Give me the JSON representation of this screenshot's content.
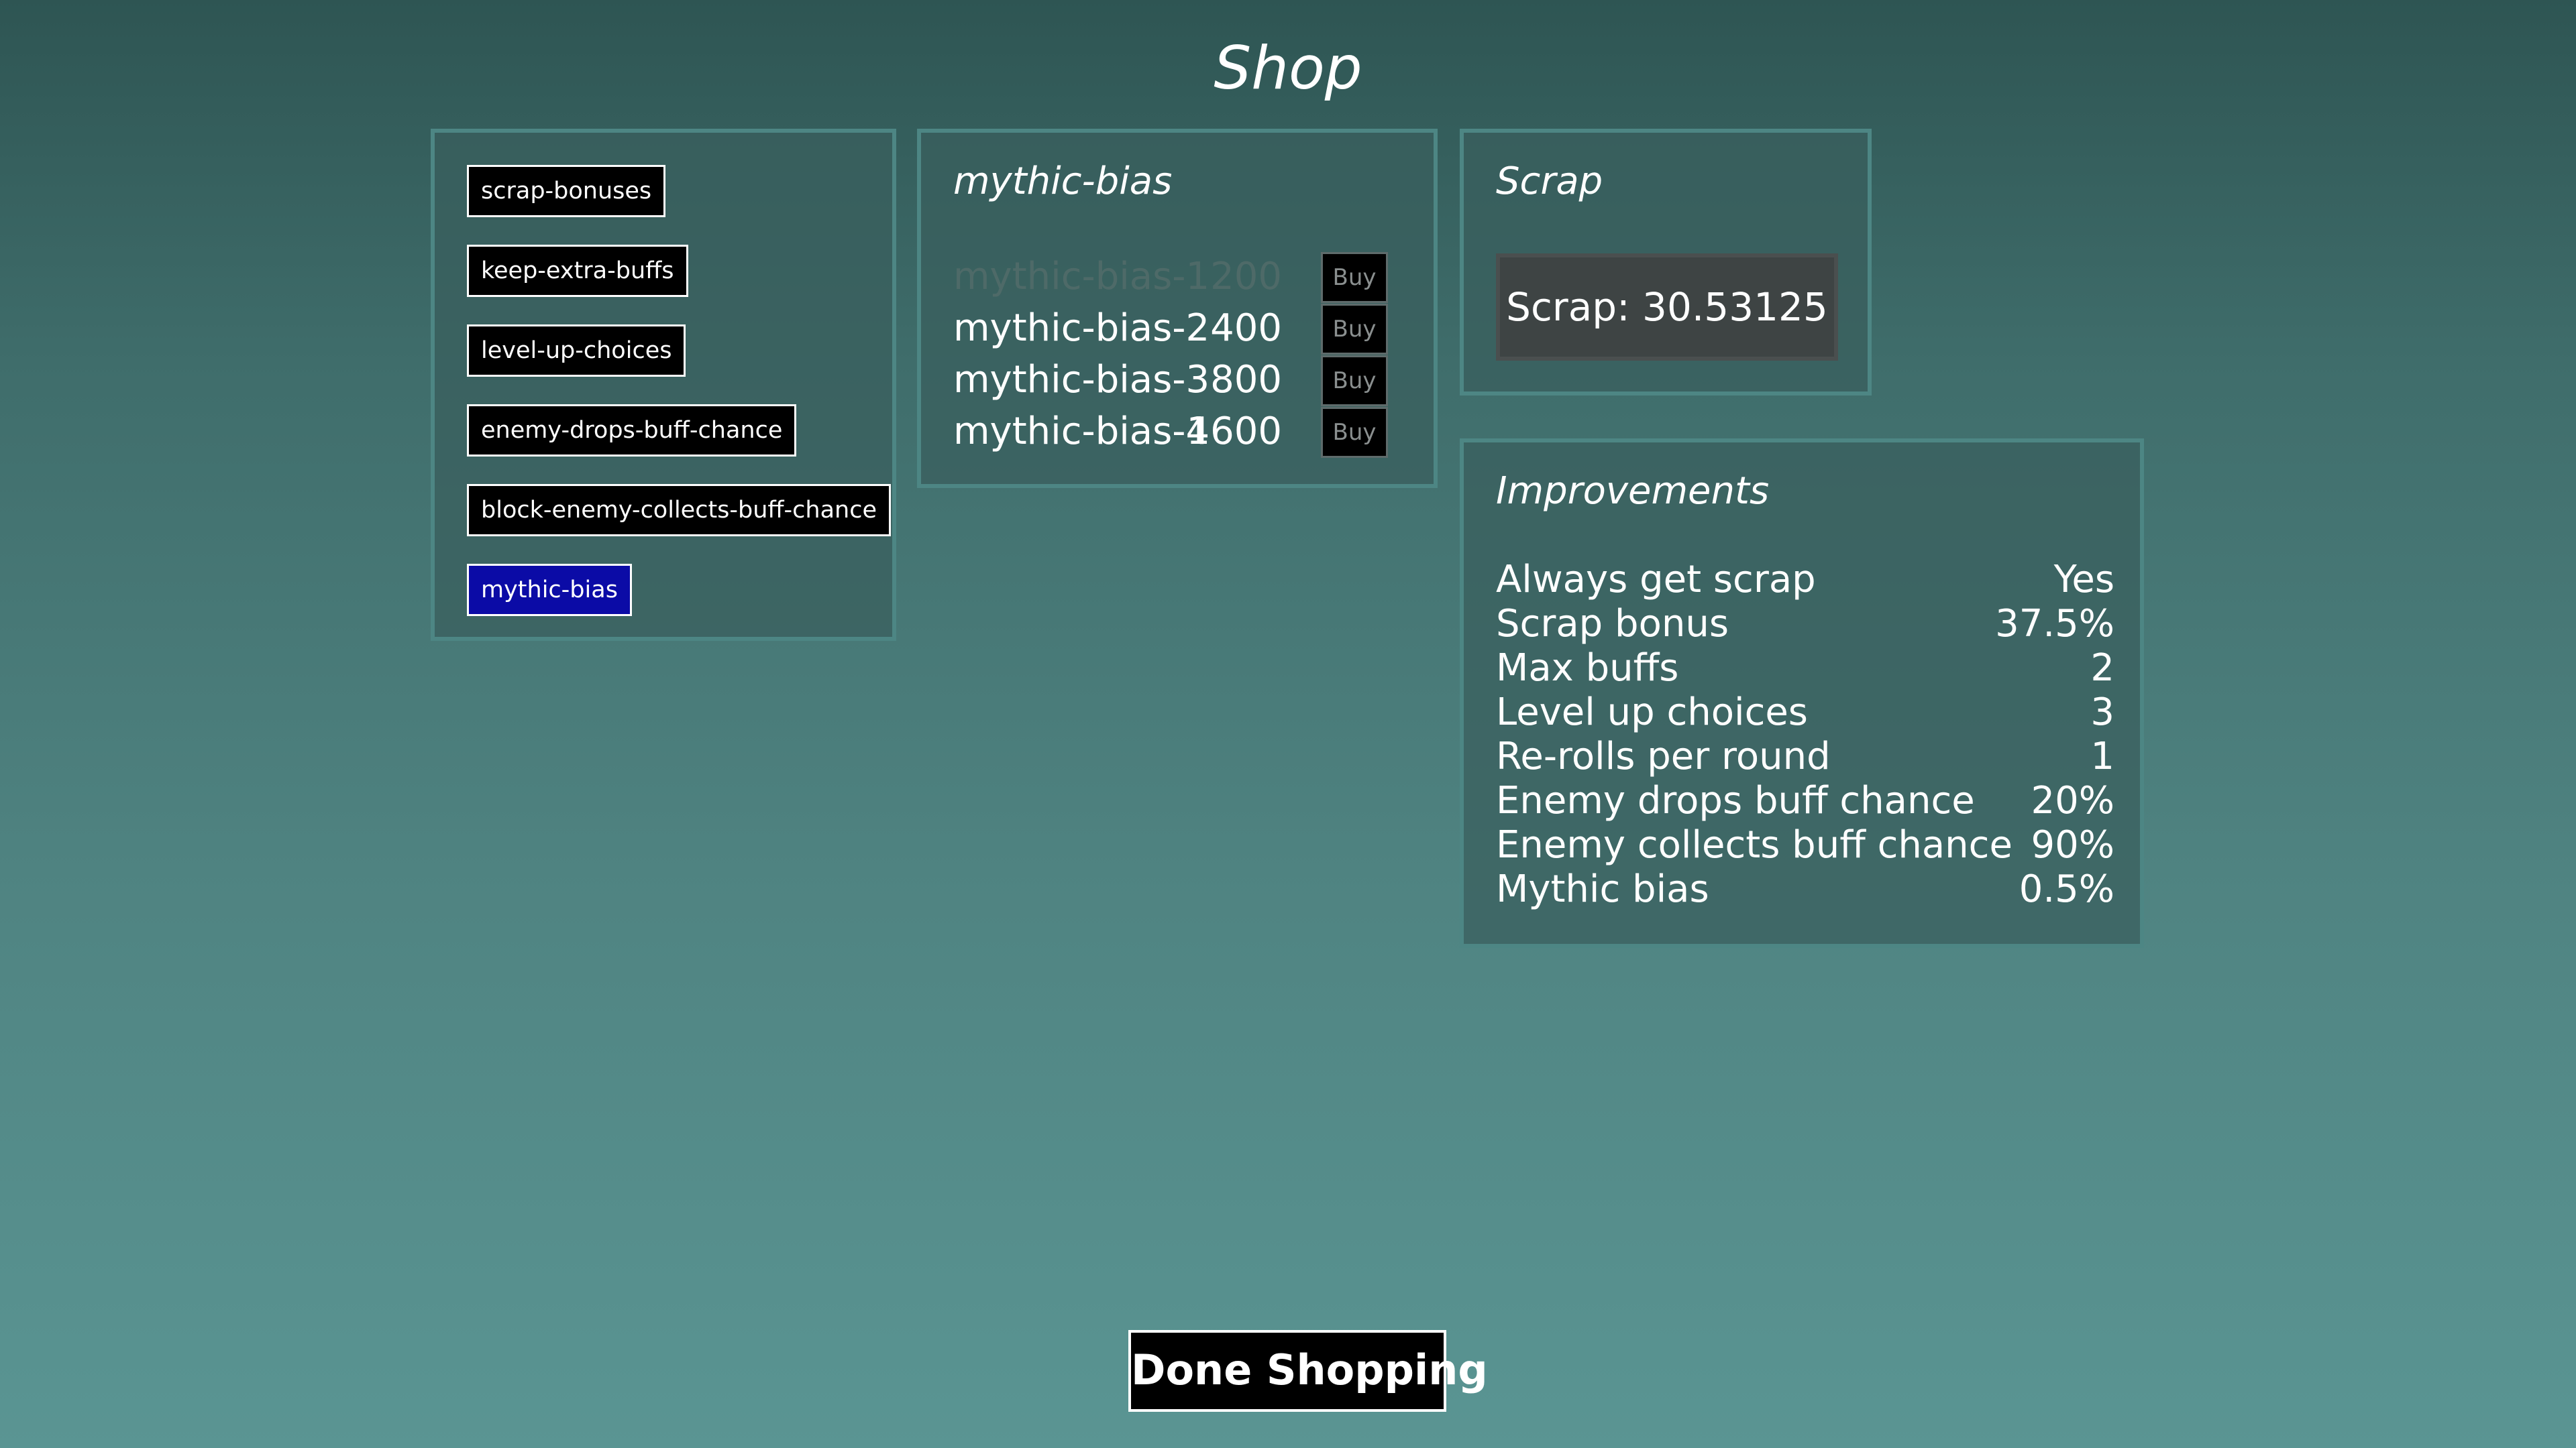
{
  "title": "Shop",
  "categories": [
    {
      "label": "scrap-bonuses",
      "selected": false
    },
    {
      "label": "keep-extra-buffs",
      "selected": false
    },
    {
      "label": "level-up-choices",
      "selected": false
    },
    {
      "label": "enemy-drops-buff-chance",
      "selected": false
    },
    {
      "label": "block-enemy-collects-buff-chance",
      "selected": false
    },
    {
      "label": "mythic-bias",
      "selected": true
    }
  ],
  "upgrades": {
    "heading": "mythic-bias",
    "items": [
      {
        "name": "mythic-bias-1",
        "cost": "200",
        "buy_label": "Buy",
        "owned": true
      },
      {
        "name": "mythic-bias-2",
        "cost": "400",
        "buy_label": "Buy",
        "owned": false
      },
      {
        "name": "mythic-bias-3",
        "cost": "800",
        "buy_label": "Buy",
        "owned": false
      },
      {
        "name": "mythic-bias-4",
        "cost": "1600",
        "buy_label": "Buy",
        "owned": false
      }
    ]
  },
  "scrap": {
    "heading": "Scrap",
    "value_text": "Scrap: 30.53125"
  },
  "improvements": {
    "heading": "Improvements",
    "rows": [
      {
        "label": "Always get scrap",
        "value": "Yes"
      },
      {
        "label": "Scrap bonus",
        "value": "37.5%"
      },
      {
        "label": "Max buffs",
        "value": "2"
      },
      {
        "label": "Level up choices",
        "value": "3"
      },
      {
        "label": "Re-rolls per round",
        "value": "1"
      },
      {
        "label": "Enemy drops buff chance",
        "value": "20%"
      },
      {
        "label": "Enemy collects buff chance",
        "value": "90%"
      },
      {
        "label": "Mythic bias",
        "value": "0.5%"
      }
    ]
  },
  "done_label": "Done Shopping",
  "colors": {
    "selected_category": "#0b0ba6",
    "owned_text": "#4e6a68"
  }
}
